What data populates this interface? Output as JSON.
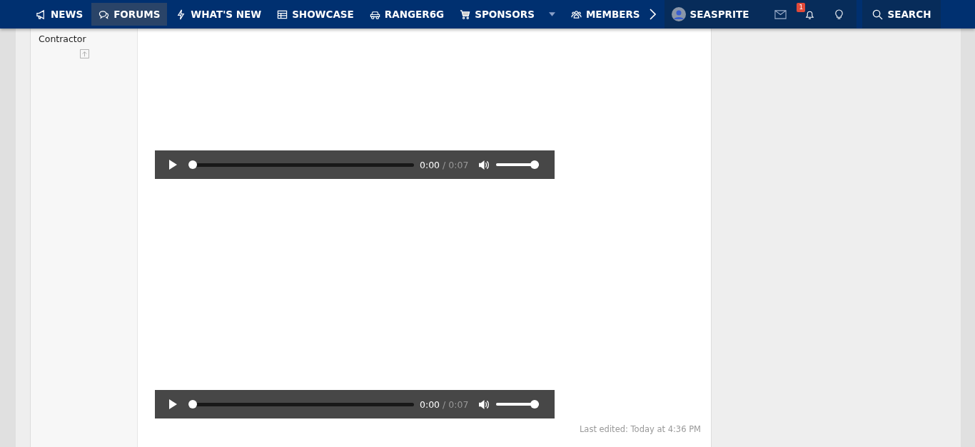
{
  "nav": {
    "items": [
      {
        "label": "NEWS",
        "kind": "megaphone",
        "selected": false,
        "dropdown": false
      },
      {
        "label": "FORUMS",
        "kind": "chat",
        "selected": true,
        "dropdown": false
      },
      {
        "label": "WHAT'S NEW",
        "kind": "bolt",
        "selected": false,
        "dropdown": false
      },
      {
        "label": "SHOWCASE",
        "kind": "table",
        "selected": false,
        "dropdown": false
      },
      {
        "label": "RANGER6G",
        "kind": "vehicle",
        "selected": false,
        "dropdown": false
      },
      {
        "label": "SPONSORS",
        "kind": "cart",
        "selected": false,
        "dropdown": true
      },
      {
        "label": "MEMBERS",
        "kind": "people",
        "selected": false,
        "dropdown": false
      }
    ],
    "user": {
      "name": "SEASPRITE"
    },
    "alerts_badge": "1",
    "search": "SEARCH"
  },
  "sidebar": {
    "user_title": "Contractor"
  },
  "players": [
    {
      "current": "0:00",
      "duration": "/ 0:07",
      "level": 0,
      "volume": {
        "level": 1
      }
    },
    {
      "current": "0:00",
      "duration": "/ 0:07",
      "level": 0,
      "volume": {
        "level": 1
      }
    }
  ],
  "last_edited": "Last edited: Today at 4:36 PM"
}
